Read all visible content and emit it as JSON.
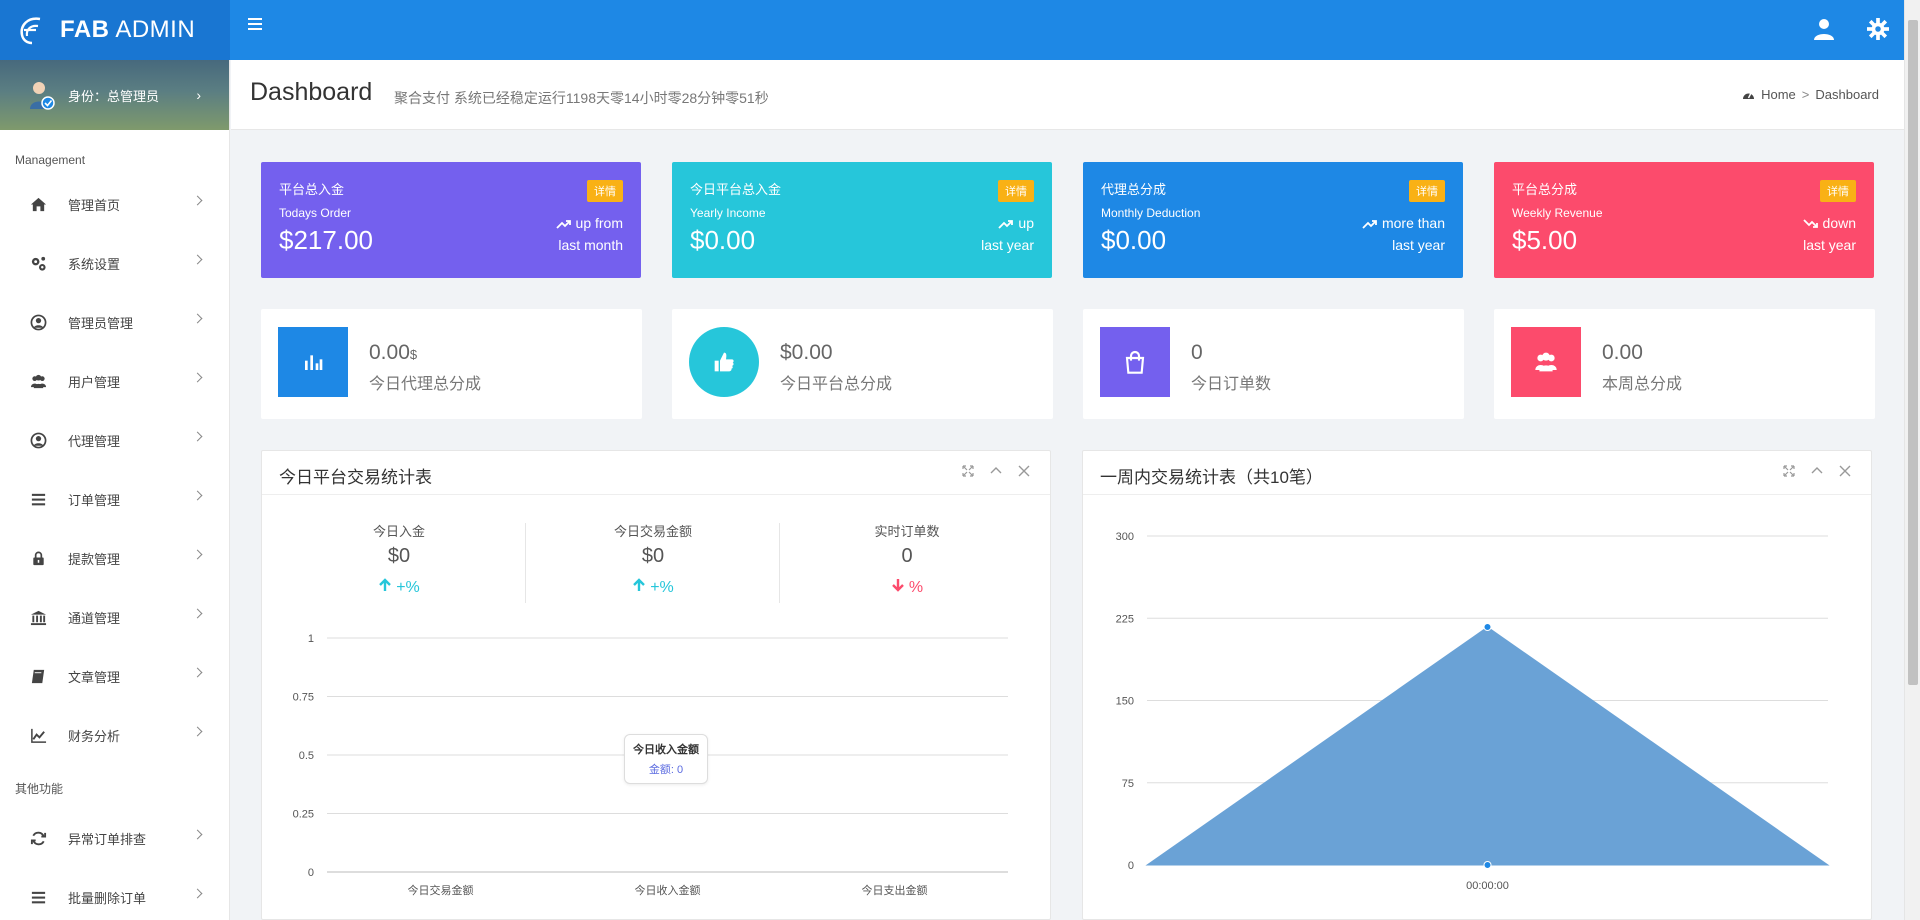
{
  "brand": {
    "bold": "FAB",
    "rest": " ADMIN"
  },
  "profile": {
    "role": "身份：总管理员",
    "chevron": "›"
  },
  "sidebar": {
    "section1": "Management",
    "items": [
      {
        "label": "管理首页",
        "icon": "home-icon"
      },
      {
        "label": "系统设置",
        "icon": "cogs-icon"
      },
      {
        "label": "管理员管理",
        "icon": "user-circle-icon"
      },
      {
        "label": "用户管理",
        "icon": "users-icon"
      },
      {
        "label": "代理管理",
        "icon": "user-circle-icon"
      },
      {
        "label": "订单管理",
        "icon": "list-icon"
      },
      {
        "label": "提款管理",
        "icon": "lock-icon"
      },
      {
        "label": "通道管理",
        "icon": "bank-icon"
      },
      {
        "label": "文章管理",
        "icon": "book-icon"
      },
      {
        "label": "财务分析",
        "icon": "line-chart-icon"
      }
    ],
    "section2": "其他功能",
    "items2": [
      {
        "label": "异常订单排查",
        "icon": "refresh-icon"
      },
      {
        "label": "批量删除订单",
        "icon": "list-icon"
      }
    ]
  },
  "header": {
    "title": "Dashboard",
    "subtitle": "聚合支付 系统已经稳定运行1198天零14小时零28分钟零51秒",
    "breadcrumb": {
      "home": "Home",
      "sep": ">",
      "current": "Dashboard"
    }
  },
  "stats": [
    {
      "label1": "平台总入金",
      "label2": "Todays Order",
      "value": "$217.00",
      "badge": "详情",
      "trend_line1": "up from",
      "trend_line2": "last month",
      "direction": "up",
      "color": "#7460ee"
    },
    {
      "label1": "今日平台总入金",
      "label2": "Yearly Income",
      "value": "$0.00",
      "badge": "详情",
      "trend_line1": "up",
      "trend_line2": "last year",
      "direction": "up",
      "color": "#26c6da"
    },
    {
      "label1": "代理总分成",
      "label2": "Monthly Deduction",
      "value": "$0.00",
      "badge": "详情",
      "trend_line1": "more than",
      "trend_line2": "last year",
      "direction": "up",
      "color": "#1e88e5"
    },
    {
      "label1": "平台总分成",
      "label2": "Weekly Revenue",
      "value": "$5.00",
      "badge": "详情",
      "trend_line1": "down",
      "trend_line2": "last year",
      "direction": "down",
      "color": "#fc4b6c"
    }
  ],
  "infos": [
    {
      "value": "0.00",
      "suffix": "$",
      "label": "今日代理总分成",
      "icon": "bar-chart-icon",
      "color": "#1e88e5",
      "shape": "square"
    },
    {
      "value": "$0.00",
      "suffix": "",
      "label": "今日平台总分成",
      "icon": "thumbs-up-icon",
      "color": "#26c6da",
      "shape": "circle"
    },
    {
      "value": "0",
      "suffix": "",
      "label": "今日订单数",
      "icon": "shopping-bag-icon",
      "color": "#7460ee",
      "shape": "square"
    },
    {
      "value": "0.00",
      "suffix": "",
      "label": "本周总分成",
      "icon": "users-icon",
      "color": "#fc4b6c",
      "shape": "square"
    }
  ],
  "panel_left": {
    "title": "今日平台交易统计表",
    "kpis": [
      {
        "label": "今日入金",
        "value": "$0",
        "delta": "+%",
        "direction": "up"
      },
      {
        "label": "今日交易金额",
        "value": "$0",
        "delta": "+%",
        "direction": "up"
      },
      {
        "label": "实时订单数",
        "value": "0",
        "delta": "%",
        "direction": "down"
      }
    ],
    "tooltip": {
      "title": "今日收入金额",
      "body": "金额: 0"
    }
  },
  "panel_right": {
    "title": "一周内交易统计表（共10笔）"
  },
  "colors": {
    "up": "#26c6da",
    "down": "#fc4b6c",
    "area": "#6aa2d6",
    "point": "#1e88e5"
  },
  "chart_data": [
    {
      "type": "bar",
      "categories": [
        "今日交易金额",
        "今日收入金额",
        "今日支出金额"
      ],
      "values": [
        0,
        0,
        0
      ],
      "yticks": [
        "1",
        "0.75",
        "0.5",
        "0.25",
        "0"
      ],
      "ylim": [
        0,
        1
      ]
    },
    {
      "type": "area",
      "x": [
        "",
        "00:00:00",
        ""
      ],
      "values": [
        0,
        217,
        0
      ],
      "yticks": [
        "300",
        "225",
        "150",
        "75",
        "0"
      ],
      "ylim": [
        0,
        300
      ]
    }
  ]
}
